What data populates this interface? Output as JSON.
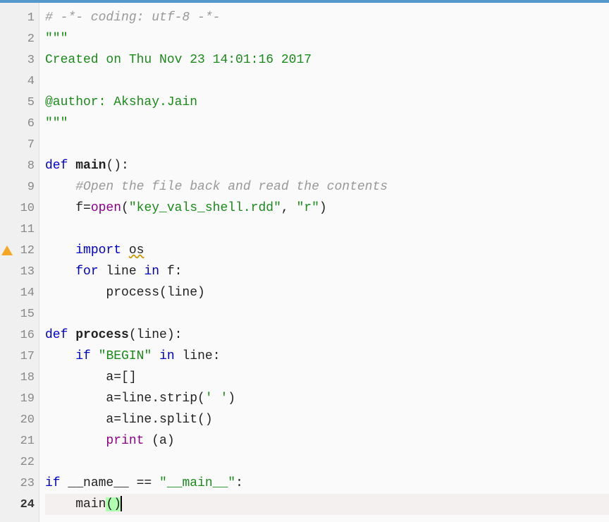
{
  "editor": {
    "lineCount": 24,
    "currentLine": 24,
    "warningLines": [
      12
    ],
    "lines": {
      "1": [
        {
          "cls": "comment",
          "text": "# -*- coding: utf-8 -*-"
        }
      ],
      "2": [
        {
          "cls": "docstring",
          "text": "\"\"\""
        }
      ],
      "3": [
        {
          "cls": "docstring",
          "text": "Created on Thu Nov 23 14:01:16 2017"
        }
      ],
      "4": [],
      "5": [
        {
          "cls": "docstring",
          "text": "@author: Akshay.Jain"
        }
      ],
      "6": [
        {
          "cls": "docstring",
          "text": "\"\"\""
        }
      ],
      "7": [],
      "8": [
        {
          "cls": "keyword",
          "text": "def"
        },
        {
          "cls": "",
          "text": " "
        },
        {
          "cls": "fname",
          "text": "main"
        },
        {
          "cls": "",
          "text": "():"
        }
      ],
      "9": [
        {
          "cls": "",
          "text": "    "
        },
        {
          "cls": "comment",
          "text": "#Open the file back and read the contents"
        }
      ],
      "10": [
        {
          "cls": "",
          "text": "    f="
        },
        {
          "cls": "builtin",
          "text": "open"
        },
        {
          "cls": "",
          "text": "("
        },
        {
          "cls": "string",
          "text": "\"key_vals_shell.rdd\""
        },
        {
          "cls": "",
          "text": ", "
        },
        {
          "cls": "string",
          "text": "\"r\""
        },
        {
          "cls": "",
          "text": ")"
        }
      ],
      "11": [],
      "12": [
        {
          "cls": "",
          "text": "    "
        },
        {
          "cls": "keyword-import",
          "text": "import"
        },
        {
          "cls": "",
          "text": " "
        },
        {
          "cls": "underline-wavy",
          "text": "os"
        }
      ],
      "13": [
        {
          "cls": "",
          "text": "    "
        },
        {
          "cls": "keyword",
          "text": "for"
        },
        {
          "cls": "",
          "text": " line "
        },
        {
          "cls": "keyword",
          "text": "in"
        },
        {
          "cls": "",
          "text": " f:"
        }
      ],
      "14": [
        {
          "cls": "",
          "text": "        process(line)"
        }
      ],
      "15": [],
      "16": [
        {
          "cls": "keyword",
          "text": "def"
        },
        {
          "cls": "",
          "text": " "
        },
        {
          "cls": "fname",
          "text": "process"
        },
        {
          "cls": "",
          "text": "(line):"
        }
      ],
      "17": [
        {
          "cls": "",
          "text": "    "
        },
        {
          "cls": "keyword",
          "text": "if"
        },
        {
          "cls": "",
          "text": " "
        },
        {
          "cls": "string",
          "text": "\"BEGIN\""
        },
        {
          "cls": "",
          "text": " "
        },
        {
          "cls": "keyword",
          "text": "in"
        },
        {
          "cls": "",
          "text": " line:"
        }
      ],
      "18": [
        {
          "cls": "",
          "text": "        a=[]"
        }
      ],
      "19": [
        {
          "cls": "",
          "text": "        a=line.strip("
        },
        {
          "cls": "string",
          "text": "' '"
        },
        {
          "cls": "",
          "text": ")"
        }
      ],
      "20": [
        {
          "cls": "",
          "text": "        a=line.split()"
        }
      ],
      "21": [
        {
          "cls": "",
          "text": "        "
        },
        {
          "cls": "builtin",
          "text": "print"
        },
        {
          "cls": "",
          "text": " (a)"
        }
      ],
      "22": [],
      "23": [
        {
          "cls": "keyword",
          "text": "if"
        },
        {
          "cls": "",
          "text": " __name__ == "
        },
        {
          "cls": "string",
          "text": "\"__main__\""
        },
        {
          "cls": "",
          "text": ":"
        }
      ],
      "24": [
        {
          "cls": "",
          "text": "    main"
        },
        {
          "cls": "paren-match",
          "text": "("
        },
        {
          "cls": "paren-match",
          "text": ")"
        },
        {
          "cls": "cursor",
          "text": ""
        }
      ]
    }
  }
}
